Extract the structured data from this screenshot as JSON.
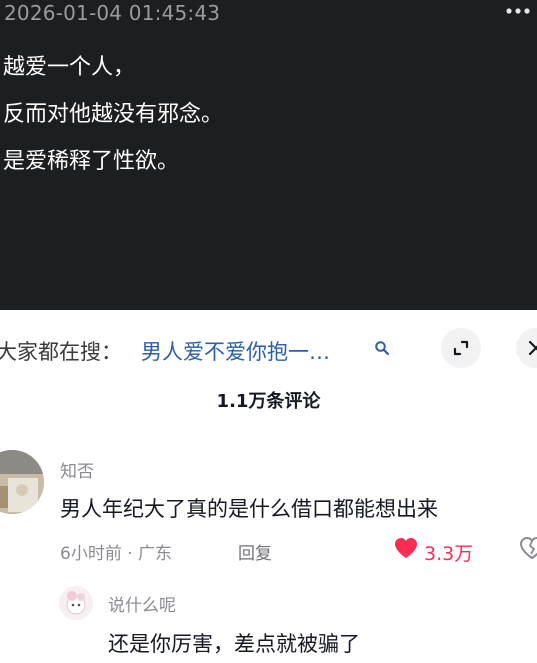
{
  "video": {
    "timestamp": "2026-01-04 01:45:43",
    "more_icon": "more-dots-icon",
    "caption_lines": [
      "越爱一个人，",
      "反而对他越没有邪念。",
      "是爱稀释了性欲。"
    ]
  },
  "sheet": {
    "search_prefix": "大家都在搜：",
    "search_query": "男人爱不爱你抱一…",
    "search_icon": "search-icon",
    "expand_icon": "expand-icon",
    "close_icon": "close-icon",
    "comment_count": "1.1万条评论"
  },
  "comments": [
    {
      "username": "知否",
      "text": "男人年纪大了真的是什么借口都能想出来",
      "meta": "6小时前 · 广东",
      "reply_label": "回复",
      "likes": "3.3万",
      "like_icon": "heart-filled-icon",
      "dislike_icon": "dislike-icon",
      "like_color": "#fe2c55"
    }
  ],
  "replies": [
    {
      "username": "说什么呢",
      "text": "还是你厉害，差点就被骗了"
    }
  ]
}
